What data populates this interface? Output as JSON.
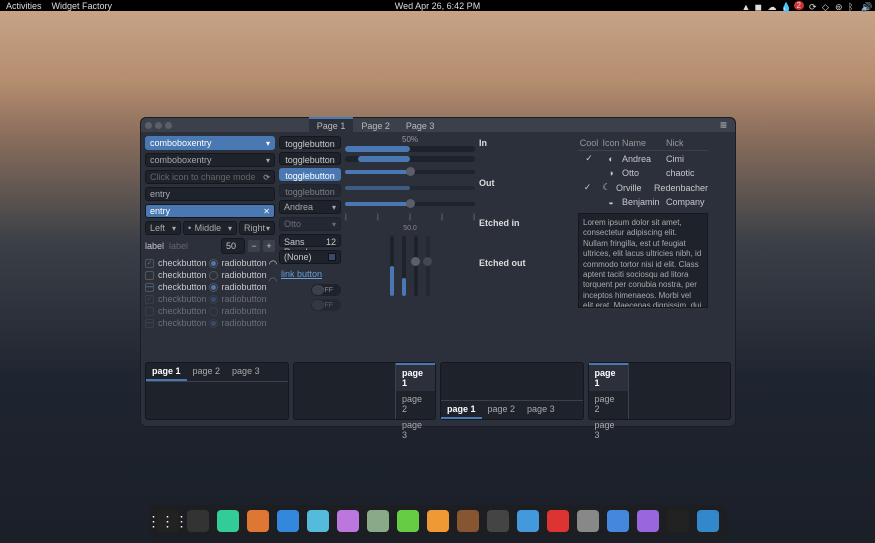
{
  "topbar": {
    "activities": "Activities",
    "app": "Widget Factory",
    "datetime": "Wed Apr 26,  6:42 PM",
    "badge": "2"
  },
  "titlebar": {
    "tabs": [
      "Page 1",
      "Page 2",
      "Page 3"
    ],
    "active": 0
  },
  "col1": {
    "combo1": "comboboxentry",
    "combo2": "comboboxentry",
    "entry_icon_placeholder": "Click icon to change mode",
    "entry1": "entry",
    "entry2": "entry",
    "align": {
      "left": "Left",
      "middle": "Middle",
      "right": "Right"
    },
    "labelrow": {
      "label1": "label",
      "label2": "label",
      "spin": "50"
    },
    "checks": [
      "checkbutton",
      "checkbutton",
      "checkbutton",
      "checkbutton",
      "checkbutton",
      "checkbutton"
    ],
    "radios": [
      "radiobutton",
      "radiobutton",
      "radiobutton",
      "radiobutton",
      "radiobutton",
      "radiobutton"
    ]
  },
  "col2": {
    "toggles": [
      "togglebutton",
      "togglebutton",
      "togglebutton",
      "togglebutton"
    ],
    "combo_name": "Andrea",
    "combo_name2": "Otto",
    "font_name": "Sans Regular",
    "font_size": "12",
    "color": "(None)",
    "link": "link button",
    "off1": "OFF",
    "off2": "OFF"
  },
  "col3": {
    "prog_label": "50%",
    "slider_val": "50.0"
  },
  "frames": {
    "in": "In",
    "out": "Out",
    "ein": "Etched in",
    "eout": "Etched out"
  },
  "table": {
    "headers": {
      "cool": "Cool",
      "icon": "Icon",
      "name": "Name",
      "nick": "Nick"
    },
    "rows": [
      {
        "cool": true,
        "icon": "◐",
        "name": "Andrea",
        "nick": "Cimi"
      },
      {
        "cool": false,
        "icon": "◑",
        "name": "Otto",
        "nick": "chaotic"
      },
      {
        "cool": true,
        "icon": "☾",
        "name": "Orville",
        "nick": "Redenbacher"
      },
      {
        "cool": false,
        "icon": "◒",
        "name": "Benjamin",
        "nick": "Company"
      }
    ]
  },
  "lorem": "Lorem ipsum dolor sit amet, consectetur adipiscing elit. Nullam fringilla, est ut feugiat ultrices, elit lacus ultricies nibh, id commodo tortor nisi id elit. Class aptent taciti sociosqu ad litora torquent per conubia nostra, per inceptos himenaeos. Morbi vel elit erat. Maecenas dignissim, dui et pharetra rutrum, tellus lectus rutrum mi, a convallis libero nisi quis tellus. Nulla facilisi. Nullam eleifend lobortis",
  "bottom_tabs": {
    "labels": [
      "page 1",
      "page 2",
      "page 3"
    ]
  },
  "dock": {
    "colors": [
      "#333",
      "#3c9",
      "#d73",
      "#38d",
      "#5bd",
      "#b7d",
      "#8a8",
      "#6c4",
      "#e93",
      "#853",
      "#444",
      "#49d",
      "#d33",
      "#888",
      "#48d",
      "#96d",
      "#222",
      "#38c"
    ]
  }
}
